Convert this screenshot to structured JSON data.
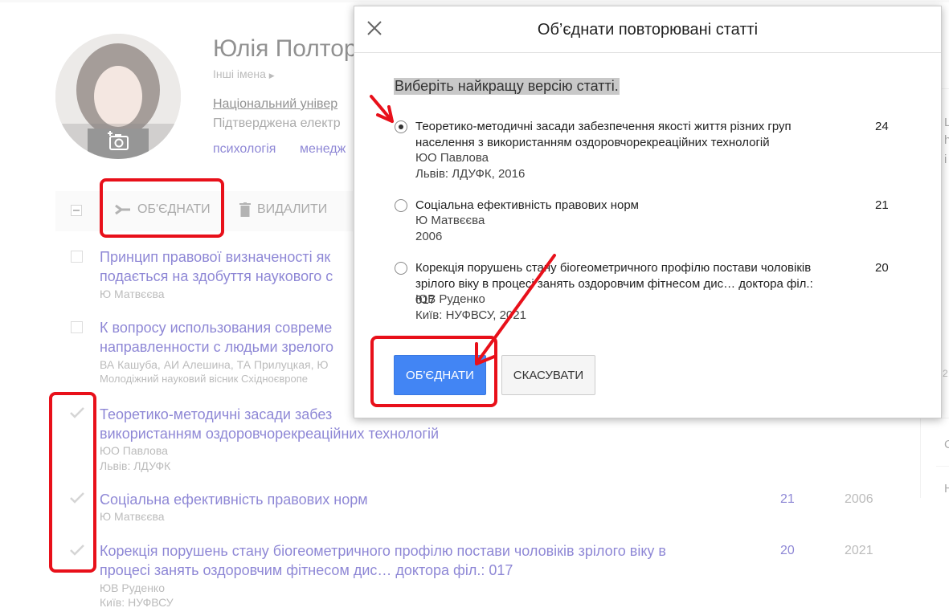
{
  "profile": {
    "name": "Юлія Полтор",
    "other_names": "Інші імена",
    "affiliation": "Національний універ",
    "verified": "Підтверджена електр",
    "tags": [
      "психологія",
      "менедж"
    ]
  },
  "toolbar": {
    "merge_label": "ОБ'ЄДНАТИ",
    "delete_label": "ВИДАЛИТИ"
  },
  "articles": [
    {
      "title_lines": [
        "Принцип правової визначеності як",
        "подається на здобуття наукового с"
      ],
      "authors": "Ю Матвєєва",
      "source": "",
      "checked": false,
      "cited": "",
      "year": ""
    },
    {
      "title_lines": [
        "К вопросу использования совреме",
        "направленности с людьми зрелого"
      ],
      "authors": "ВА Кашуба, АИ Алешина, ТА Прилуцкая, Ю",
      "source": "Молодіжний науковий вісник Східноєвропе",
      "checked": false,
      "cited": "",
      "year": ""
    },
    {
      "title_lines": [
        "Теоретико-методичні засади забез",
        "використанням оздоровчорекреаційних технологій"
      ],
      "authors": "ЮО Павлова",
      "source": "Львів: ЛДУФК",
      "checked": true,
      "cited": "",
      "year": ""
    },
    {
      "title_lines": [
        "Соціальна ефективність правових норм"
      ],
      "authors": "Ю Матвєєва",
      "source": "",
      "checked": true,
      "cited": "21",
      "year": "2006"
    },
    {
      "title_lines": [
        "Корекція порушень стану біогеометричного профілю постави чоловіків зрілого віку в",
        "процесі занять оздоровчим фітнесом дис… доктора філ.: 017"
      ],
      "authors": "ЮВ Руденко",
      "source": "Київ: НУФВСУ",
      "checked": true,
      "cited": "20",
      "year": "2021"
    }
  ],
  "dialog": {
    "title": "Об’єднати повторювані статті",
    "instruction": "Виберіть найкращу версію статті.",
    "options": [
      {
        "title_lines": [
          "Теоретико-методичні засади забезпечення якості життя різних груп",
          "населення з використанням оздоровчорекреаційних технологій"
        ],
        "author": "ЮО Павлова",
        "source": "Львів: ЛДУФК, 2016",
        "cited": "24",
        "selected": true
      },
      {
        "title_lines": [
          "Соціальна ефективність правових норм"
        ],
        "author": "Ю Матвєєва",
        "source": "2006",
        "cited": "21",
        "selected": false
      },
      {
        "title_lines": [
          "Корекція порушень стану біогеометричного профілю постави чоловіків",
          "зрілого віку в процесі занять оздоровчим фітнесом дис… доктора філ.: 017"
        ],
        "author": "ЮВ Руденко",
        "source": "Київ: НУФВСУ, 2021",
        "cited": "20",
        "selected": false
      }
    ],
    "merge_button": "ОБ'ЄДНАТИ",
    "cancel_button": "СКАСУВАТИ"
  },
  "sidebar_fragments": [
    "L",
    "h",
    "i",
    "2",
    "С",
    "Н"
  ],
  "colors": {
    "link": "#1a0dab",
    "primary_button": "#4285f4",
    "annotation_red": "#e8101a"
  }
}
